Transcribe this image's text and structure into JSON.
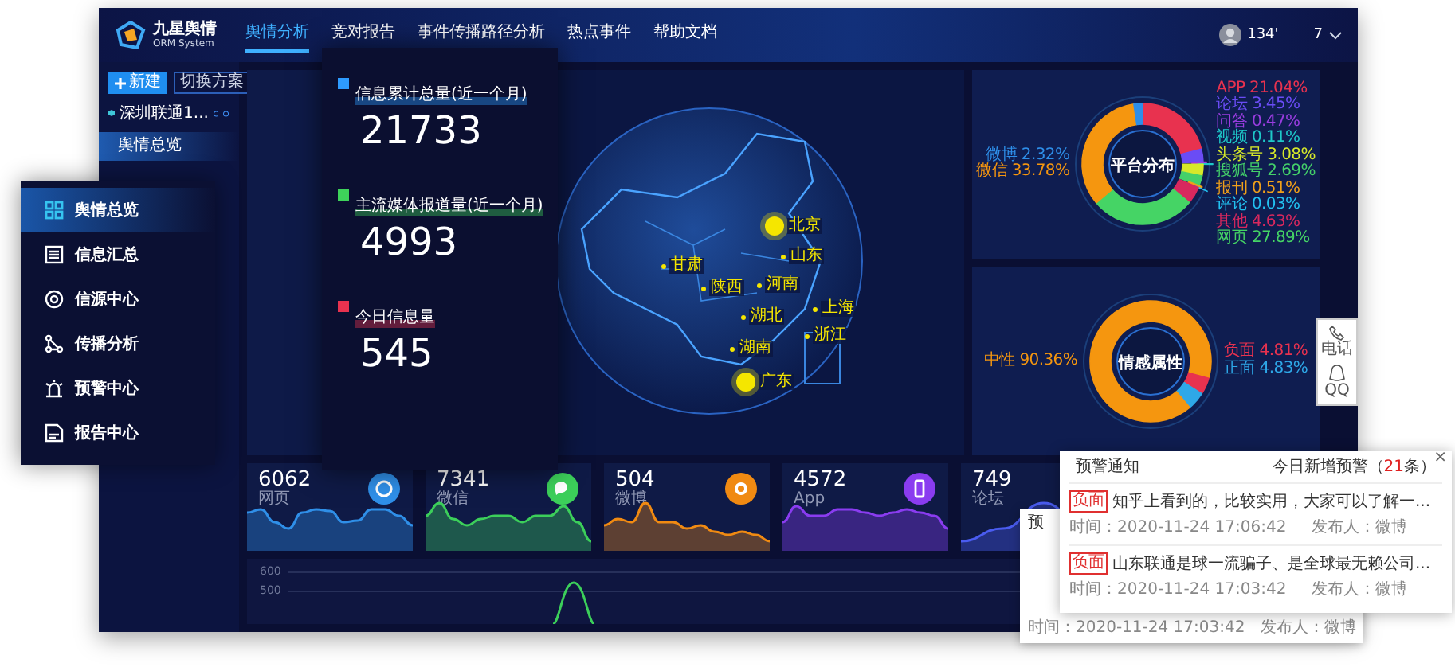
{
  "header": {
    "logo_title": "九星舆情",
    "logo_subtitle": "ORM System",
    "tabs": [
      {
        "label": "舆情分析",
        "selected": true
      },
      {
        "label": "竞对报告",
        "selected": false
      },
      {
        "label": "事件传播路径分析",
        "selected": false
      },
      {
        "label": "热点事件",
        "selected": false
      },
      {
        "label": "帮助文档",
        "selected": false
      }
    ],
    "user": "134'",
    "menu": "7"
  },
  "sidebar": {
    "new_button": "新建",
    "switch_button": "切换方案",
    "scheme": "深圳联通1...",
    "items": [
      {
        "label": "舆情总览",
        "selected": true
      }
    ]
  },
  "map": {
    "cities": [
      {
        "name": "北京",
        "major": true
      },
      {
        "name": "山东",
        "major": false
      },
      {
        "name": "甘肃",
        "major": false
      },
      {
        "name": "陕西",
        "major": false
      },
      {
        "name": "河南",
        "major": false
      },
      {
        "name": "湖北",
        "major": false
      },
      {
        "name": "上海",
        "major": false
      },
      {
        "name": "浙江",
        "major": false
      },
      {
        "name": "湖南",
        "major": false
      },
      {
        "name": "广东",
        "major": true
      }
    ]
  },
  "platform_chart": {
    "chart_data": {
      "type": "donut",
      "title": "平台分布",
      "categories": [
        "APP",
        "论坛",
        "问答",
        "视频",
        "头条号",
        "搜狐号",
        "报刊",
        "评论",
        "其他",
        "网页",
        "微信",
        "微博"
      ],
      "values": [
        21.04,
        3.45,
        0.47,
        0.11,
        3.08,
        2.69,
        0.51,
        0.03,
        4.63,
        27.89,
        33.78,
        2.32
      ],
      "value_labels": [
        "21.04%",
        "3.45%",
        "0.47%",
        "0.11%",
        "3.08%",
        "2.69%",
        "0.51%",
        "0.03%",
        "4.63%",
        "27.89%",
        "33.78%",
        "2.32%"
      ],
      "colors": [
        "#e8324f",
        "#6a4cf5",
        "#9a3de0",
        "#1ec8c8",
        "#d6e82a",
        "#44d06a",
        "#f0a01a",
        "#22c0f0",
        "#d8285e",
        "#45d465",
        "#f5960f",
        "#2e8ee8"
      ]
    }
  },
  "sentiment_chart": {
    "chart_data": {
      "type": "donut",
      "title": "情感属性",
      "categories": [
        "负面",
        "正面",
        "中性"
      ],
      "values": [
        4.81,
        4.83,
        90.36
      ],
      "value_labels": [
        "4.81%",
        "4.83%",
        "90.36%"
      ],
      "colors": [
        "#e8324f",
        "#2ea8e8",
        "#f5960f"
      ]
    }
  },
  "contact": [
    {
      "label": "电话"
    },
    {
      "label": "QQ"
    }
  ],
  "cards": [
    {
      "value": "6062",
      "label": "网页",
      "color": "#2f8fe8"
    },
    {
      "value": "7341",
      "label": "微信",
      "color": "#3ccf5a"
    },
    {
      "value": "504",
      "label": "微博",
      "color": "#f08a12"
    },
    {
      "value": "4572",
      "label": "App",
      "color": "#8a3cf0"
    },
    {
      "value": "749",
      "label": "论坛",
      "color": "#4a5cf0"
    }
  ],
  "trend_chart": {
    "y_labels": [
      "600",
      "500"
    ]
  },
  "floating_nav": {
    "items": [
      {
        "label": "舆情总览",
        "selected": true
      },
      {
        "label": "信息汇总",
        "selected": false
      },
      {
        "label": "信源中心",
        "selected": false
      },
      {
        "label": "传播分析",
        "selected": false
      },
      {
        "label": "预警中心",
        "selected": false
      },
      {
        "label": "报告中心",
        "selected": false
      }
    ]
  },
  "stats_card": {
    "stats": [
      {
        "label": "信息累计总量(近一个月)",
        "value": "21733",
        "color": "#2e9bff"
      },
      {
        "label": "主流媒体报道量(近一个月)",
        "value": "4993",
        "color": "#3ed35a"
      },
      {
        "label": "今日信息量",
        "value": "545",
        "color": "#e8324f"
      }
    ]
  },
  "back_notice": {
    "title": "预",
    "time": "时间：2020-11-24 17:03:42",
    "publisher": "发布人：微博"
  },
  "notice": {
    "title": "预警通知",
    "summary_prefix": "今日新增预警（",
    "summary_count": "21",
    "summary_suffix": "条）",
    "close": "×",
    "items": [
      {
        "tag": "负面",
        "text": "知乎上看到的，比较实用，大家可以了解一...",
        "time": "时间：2020-11-24 17:06:42",
        "publisher": "发布人：微博"
      },
      {
        "tag": "负面",
        "text": "山东联通是球一流骗子、是全球最无赖公司...",
        "time": "时间：2020-11-24 17:03:42",
        "publisher": "发布人：微博"
      }
    ]
  }
}
